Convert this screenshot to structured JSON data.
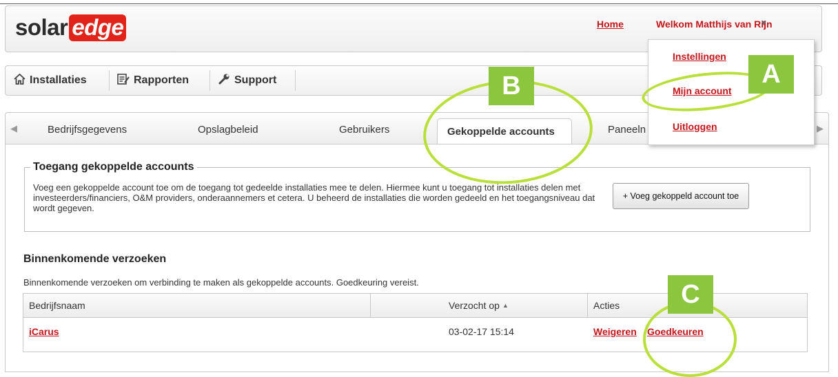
{
  "header": {
    "logo_solar": "solar",
    "logo_edge": "edge",
    "home": "Home",
    "welcome": "Welkom Matthijs van Rijn"
  },
  "nav": {
    "items": [
      {
        "label": "Installaties",
        "icon": "home-icon"
      },
      {
        "label": "Rapporten",
        "icon": "report-icon"
      },
      {
        "label": "Support",
        "icon": "wrench-icon"
      }
    ]
  },
  "account_menu": {
    "items": [
      "Instellingen",
      "Mijn account",
      "Uitloggen"
    ]
  },
  "tabs": {
    "items": [
      "Bedrijfsgegevens",
      "Opslagbeleid",
      "Gebruikers",
      "Gekoppelde accounts",
      "Paneeln"
    ],
    "active": "Gekoppelde accounts"
  },
  "access": {
    "title": "Toegang gekoppelde accounts",
    "description": "Voeg een gekoppelde account toe om de toegang tot gedeelde installaties mee te delen. Hiermee kunt u toegang tot installaties delen met investeerders/financiers, O&M providers, onderaannemers et cetera. U beheerd de installaties die worden gedeeld en het toegangsniveau dat wordt gegeven.",
    "add_button": "+ Voeg gekoppeld account toe"
  },
  "requests": {
    "title": "Binnenkomende verzoeken",
    "description": "Binnenkomende verzoeken om verbinding te maken als gekoppelde accounts. Goedkeuring vereist.",
    "columns": [
      "Bedrijfsnaam",
      "Verzocht op",
      "Acties"
    ],
    "sort_indicator": "▲",
    "rows": [
      {
        "company": "iCarus",
        "requested": "03-02-17 15:14",
        "reject": "Weigeren",
        "approve": "Goedkeuren"
      }
    ]
  },
  "annotations": {
    "a": "A",
    "b": "B",
    "c": "C",
    "color": "#8cc63f"
  },
  "colors": {
    "brand_red": "#e2231a",
    "link_red": "#c4161c"
  }
}
